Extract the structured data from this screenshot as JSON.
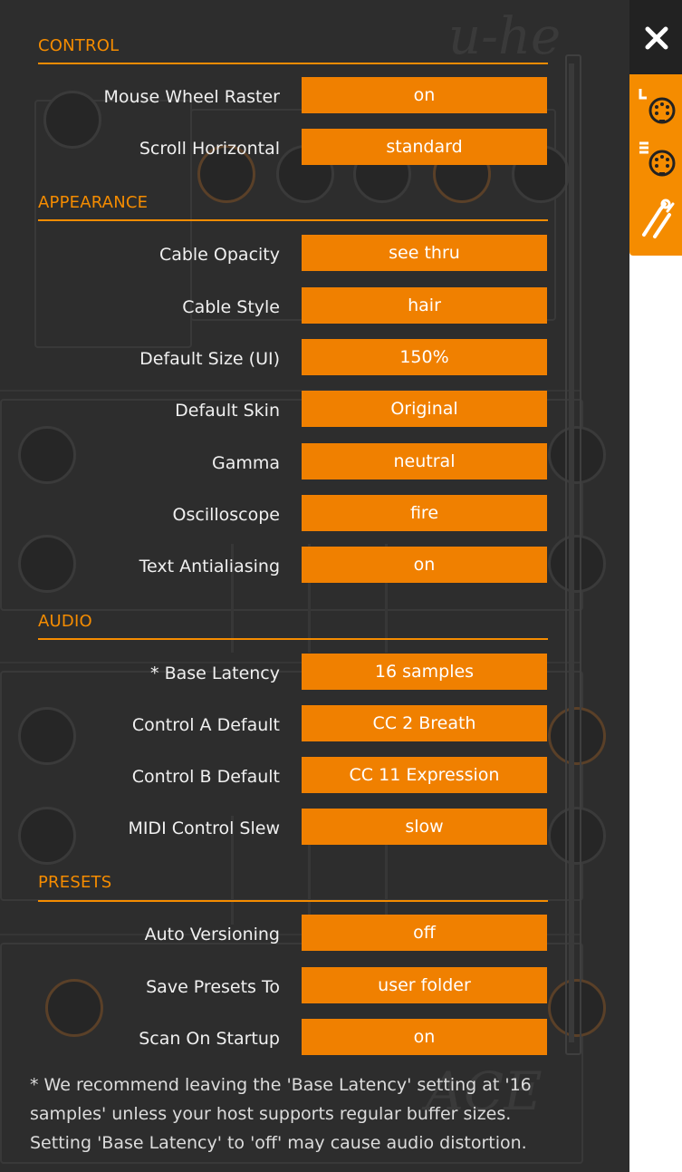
{
  "sections": [
    {
      "title": "CONTROL",
      "rows": [
        {
          "label": "Mouse Wheel Raster",
          "value": "on"
        },
        {
          "label": "Scroll Horizontal",
          "value": "standard"
        }
      ]
    },
    {
      "title": "APPEARANCE",
      "rows": [
        {
          "label": "Cable Opacity",
          "value": "see thru"
        },
        {
          "label": "Cable Style",
          "value": "hair"
        },
        {
          "label": "Default Size (UI)",
          "value": "150%"
        },
        {
          "label": "Default Skin",
          "value": "Original"
        },
        {
          "label": "Gamma",
          "value": "neutral"
        },
        {
          "label": "Oscilloscope",
          "value": "fire"
        },
        {
          "label": "Text Antialiasing",
          "value": "on"
        }
      ]
    },
    {
      "title": "AUDIO",
      "rows": [
        {
          "label": "* Base Latency",
          "value": "16 samples"
        },
        {
          "label": "Control A Default",
          "value": "CC 2 Breath"
        },
        {
          "label": "Control B Default",
          "value": "CC 11 Expression"
        },
        {
          "label": "MIDI Control Slew",
          "value": "slow"
        }
      ]
    },
    {
      "title": "PRESETS",
      "rows": [
        {
          "label": "Auto Versioning",
          "value": "off"
        },
        {
          "label": "Save Presets To",
          "value": "user folder"
        },
        {
          "label": "Scan On Startup",
          "value": "on"
        }
      ]
    }
  ],
  "footnote": {
    "line1": "* We recommend leaving the 'Base Latency' setting at '16",
    "line2": "samples' unless your host supports regular buffer sizes.",
    "line3": "Setting 'Base Latency' to 'off' may cause audio distortion."
  },
  "colors": {
    "accent": "#f58c00",
    "button": "#f08000",
    "overlay_bg": "#2d2d2d"
  },
  "icons": {
    "close": "close-icon",
    "midi_learn": "midi-learn-icon",
    "midi_table": "midi-table-icon",
    "settings": "wrench-screwdriver-icon"
  }
}
